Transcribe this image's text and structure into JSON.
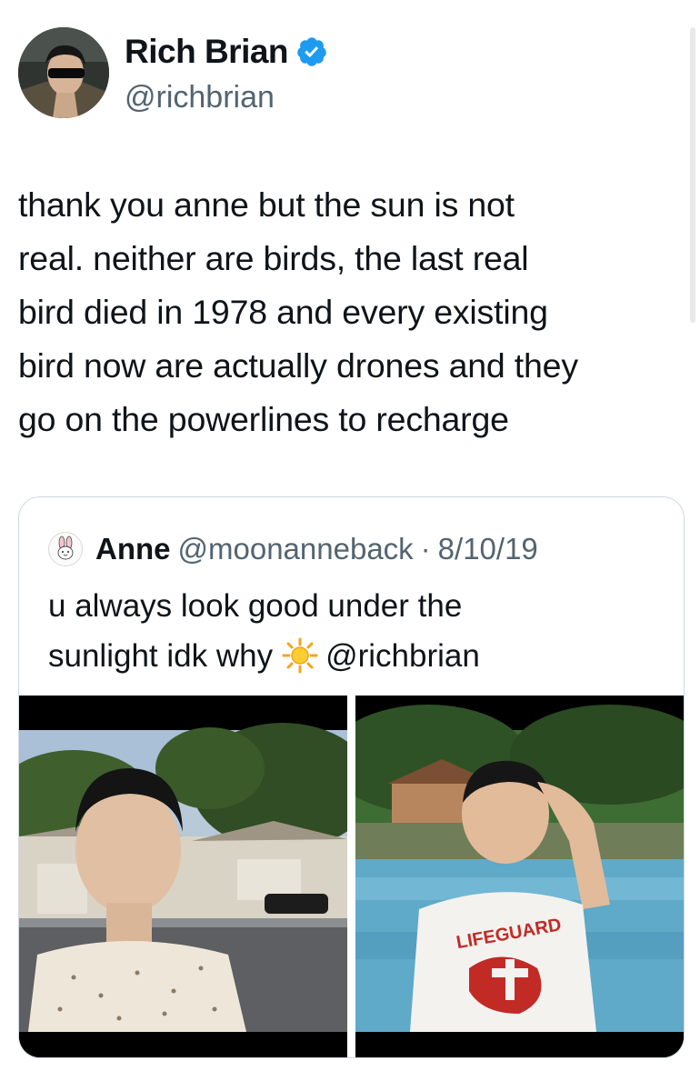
{
  "tweet": {
    "author": {
      "display_name": "Rich Brian",
      "handle": "@richbrian",
      "verified": true,
      "avatar_icon": "profile-photo"
    },
    "text_lines": [
      "thank you anne but the sun is not",
      "real. neither are birds, the last real",
      "bird died in 1978 and every existing",
      "bird now are actually drones and they",
      "go on the powerlines to recharge"
    ]
  },
  "quoted_tweet": {
    "author": {
      "display_name": "Anne",
      "handle": "@moonanneback",
      "avatar_icon": "bunny-avatar"
    },
    "separator": "·",
    "date": "8/10/19",
    "text_line1": "u always look good under the",
    "text_line2_before": "sunlight idk why",
    "text_emoji": "sun-emoji",
    "text_line2_mention": "@richbrian",
    "media": [
      {
        "icon": "video-still-suburban-street"
      },
      {
        "icon": "video-still-pool-lifeguard",
        "shirt_text": "LIFEGUARD"
      }
    ]
  },
  "colors": {
    "text": "#0f1419",
    "secondary_text": "#536471",
    "verified_badge": "#1d9bf0",
    "border": "#cfd9de"
  }
}
